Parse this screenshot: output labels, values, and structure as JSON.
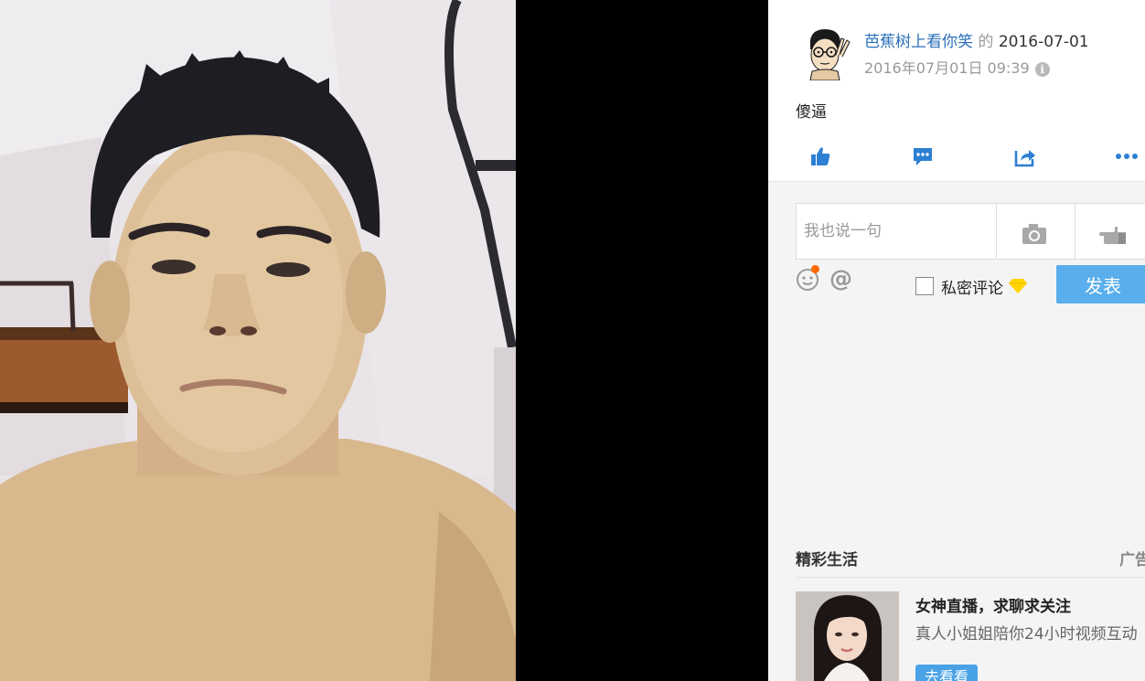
{
  "viewer": {
    "photo_alt": "selfie photo"
  },
  "post": {
    "author_name": "芭蕉树上看你笑",
    "possessive": " 的 ",
    "album_date": "2016-07-01",
    "timestamp": "2016年07月01日 09:39",
    "info_icon_glyph": "i",
    "text": "傻逼"
  },
  "actions": {
    "icons": [
      "thumbs-up-icon",
      "comment-icon",
      "share-icon",
      "more-icon"
    ],
    "color": "#2d7fd3"
  },
  "comment_form": {
    "placeholder": "我也说一句",
    "at_symbol": "@",
    "private_label": "私密评论",
    "submit_label": "发表"
  },
  "ads": {
    "section_title": "精彩生活",
    "tag": "广告",
    "item": {
      "headline": "女神直播，求聊求关注",
      "description": "真人小姐姐陪你24小时视频互动",
      "button_label": "去看看"
    }
  },
  "colors": {
    "link": "#2b6fb8",
    "accent_button": "#5aaeeb",
    "notification_dot": "#ff6a00",
    "vip_diamond": "#ffd500"
  }
}
